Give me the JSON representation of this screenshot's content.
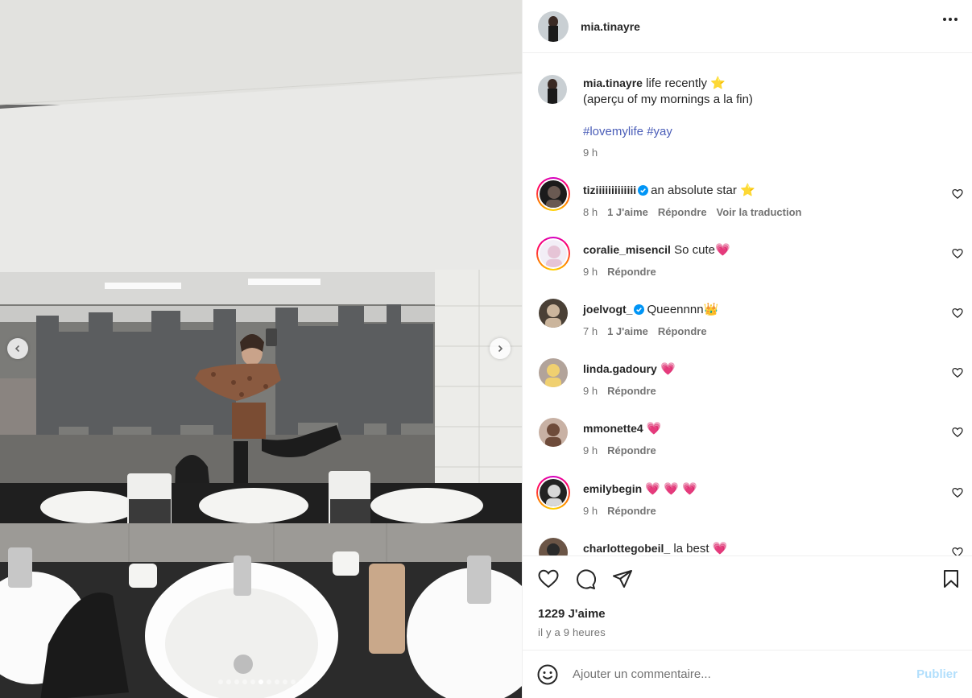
{
  "post": {
    "author": "mia.tinayre",
    "caption_line1": "life recently",
    "caption_emoji": "⭐",
    "caption_line2": "(aperçu of my mornings a la fin)",
    "hashtags": "#lovemylife #yay",
    "caption_time": "9 h",
    "carousel": {
      "slides": 11,
      "active_index": 5
    }
  },
  "comments": [
    {
      "user": "tiziiiiiiiiiiiii",
      "verified": true,
      "text": "an absolute star ⭐",
      "time": "8 h",
      "likes": "1 J'aime",
      "reply": "Répondre",
      "translate": "Voir la traduction",
      "story_ring": true
    },
    {
      "user": "coralie_misencil",
      "verified": false,
      "text": "So cute💗",
      "time": "9 h",
      "reply": "Répondre",
      "story_ring": true
    },
    {
      "user": "joelvogt_",
      "verified": true,
      "text": "Queennnn👑",
      "time": "7 h",
      "likes": "1 J'aime",
      "reply": "Répondre",
      "story_ring": false
    },
    {
      "user": "linda.gadoury",
      "verified": false,
      "text": "💗",
      "time": "9 h",
      "reply": "Répondre",
      "story_ring": false
    },
    {
      "user": "mmonette4",
      "verified": false,
      "text": "💗",
      "time": "9 h",
      "reply": "Répondre",
      "story_ring": false
    },
    {
      "user": "emilybegin",
      "verified": false,
      "text": "💗 💗 💗",
      "time": "9 h",
      "reply": "Répondre",
      "story_ring": true
    },
    {
      "user": "charlottegobeil_",
      "verified": false,
      "text": "la best 💗",
      "story_ring": false
    }
  ],
  "actions": {
    "likes": "1229 J'aime",
    "time_ago": "il y a 9 heures"
  },
  "composer": {
    "placeholder": "Ajouter un commentaire...",
    "publish_label": "Publier"
  },
  "icons": [
    "more-icon",
    "heart-icon",
    "comment-icon",
    "share-icon",
    "bookmark-icon",
    "emoji-icon",
    "chevron-left-icon",
    "chevron-right-icon",
    "verified-badge-icon"
  ],
  "colors": {
    "link": "#4a5db8",
    "muted": "#737373",
    "publish_disabled": "#b2dffc",
    "verified": "#0095f6"
  }
}
